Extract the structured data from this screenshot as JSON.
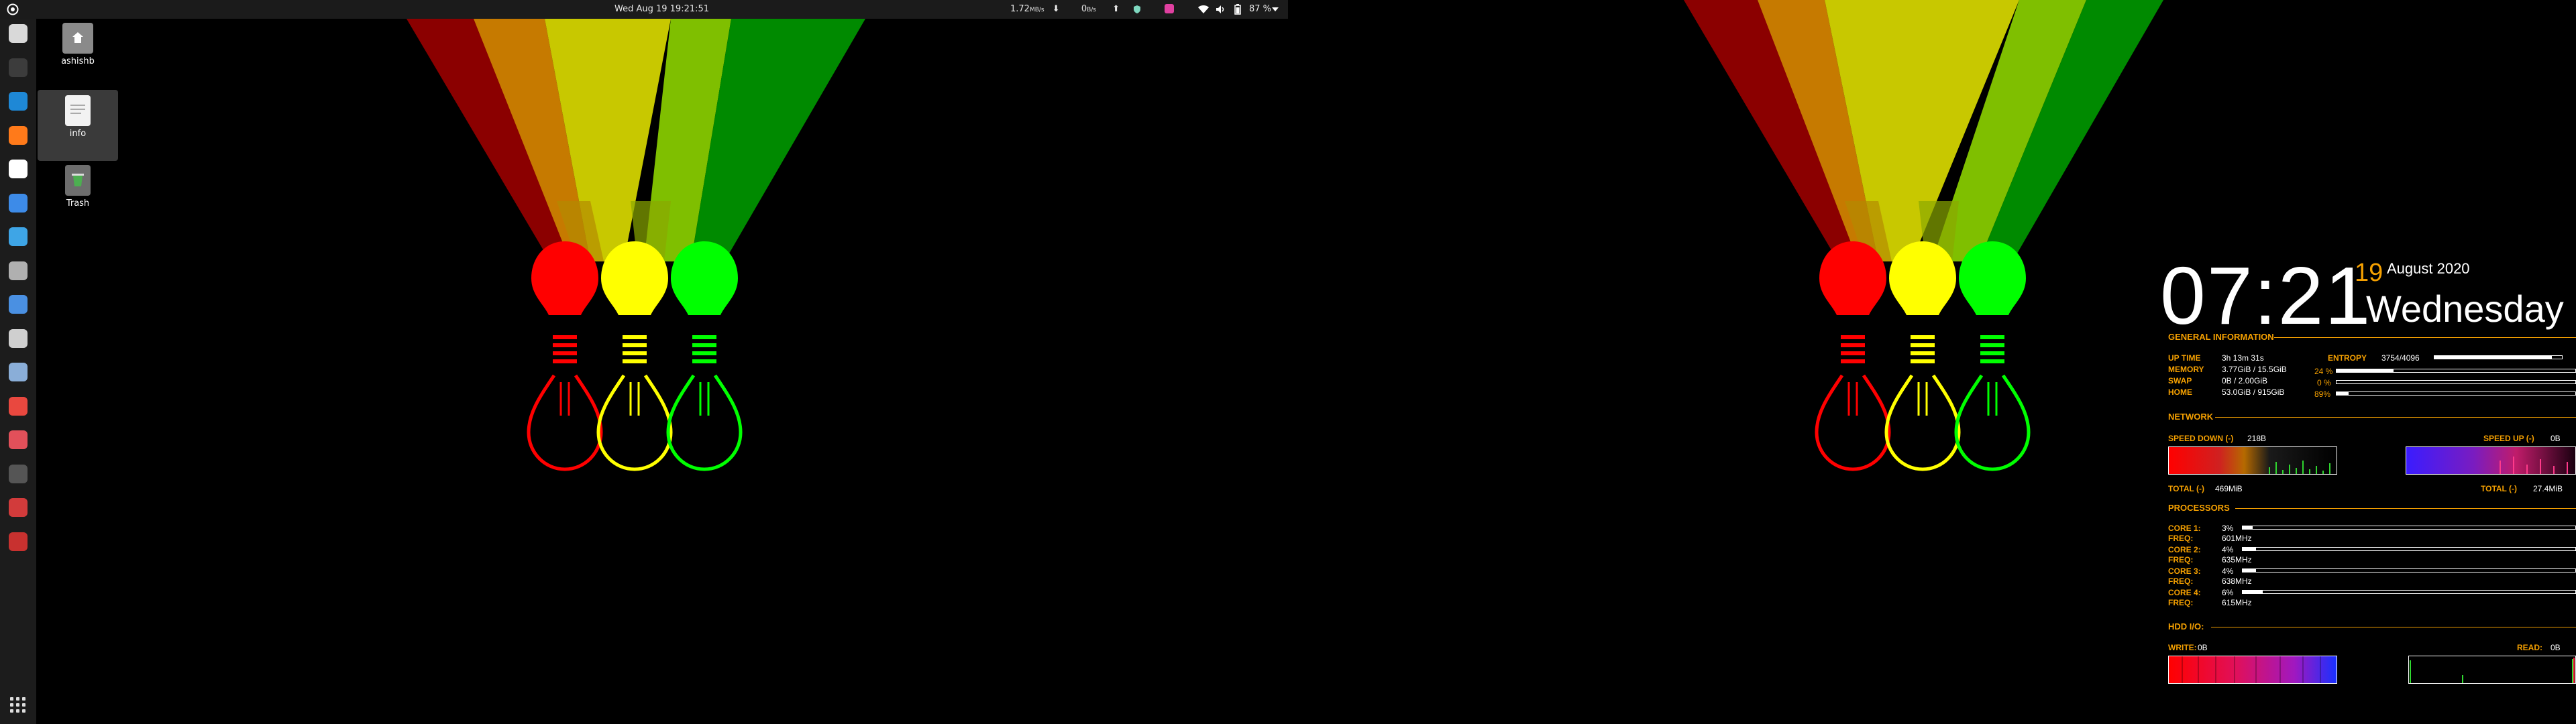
{
  "topbar": {
    "datetime": "Wed Aug 19  19:21:51",
    "net_down": "1.72",
    "net_down_unit": "MB/s",
    "net_down_arrow": "⬇",
    "net_up": "0",
    "net_up_unit": "B/s",
    "net_up_arrow": "⬆",
    "battery": "87 %"
  },
  "desktop": {
    "icons": [
      {
        "label": "ashishb"
      },
      {
        "label": "info"
      },
      {
        "label": "Trash"
      }
    ]
  },
  "dock": {
    "apps": [
      {
        "name": "files-icon",
        "color": "#d9d9d9"
      },
      {
        "name": "terminal-icon",
        "color": "#3c3c3c"
      },
      {
        "name": "vscode-icon",
        "color": "#1e88d6"
      },
      {
        "name": "firefox-icon",
        "color": "#ff7a1a"
      },
      {
        "name": "notion-icon",
        "color": "#ffffff"
      },
      {
        "name": "text-editor-icon",
        "color": "#3d8be8"
      },
      {
        "name": "telegram-icon",
        "color": "#3ea5e6"
      },
      {
        "name": "bird-app-icon",
        "color": "#b0b0b0"
      },
      {
        "name": "remote-desktop-icon",
        "color": "#4a90e2"
      },
      {
        "name": "obs-icon",
        "color": "#cfcfcf"
      },
      {
        "name": "globe-icon",
        "color": "#8aaed8"
      },
      {
        "name": "chrome-icon",
        "color": "#e9483f"
      },
      {
        "name": "system-monitor-icon",
        "color": "#e2505a"
      },
      {
        "name": "terminal-2-icon",
        "color": "#555555"
      },
      {
        "name": "flag-app-icon",
        "color": "#d23b3b"
      },
      {
        "name": "red-circle-app-icon",
        "color": "#c8312f"
      }
    ],
    "grid": "app-grid-icon"
  },
  "conky": {
    "time": "07:21",
    "day": "19",
    "month_year": "August 2020",
    "weekday": "Wednesday",
    "general": {
      "title": "GENERAL INFORMATION",
      "uptime_label": "UP TIME",
      "uptime": "3h 13m 31s",
      "memory_label": "MEMORY",
      "memory": "3.77GiB / 15.5GiB",
      "memory_pct": "24 %",
      "memory_fill": 0.24,
      "swap_label": "SWAP",
      "swap": "0B   / 2.00GiB",
      "swap_pct": "0 %",
      "swap_fill": 0.0,
      "home_label": "HOME",
      "home": "53.0GiB / 915GiB",
      "home_pct": "89%",
      "home_fill": 0.05,
      "entropy_label": "ENTROPY",
      "entropy": "3754/4096",
      "entropy_fill": 0.92
    },
    "network": {
      "title": "NETWORK",
      "down_label": "SPEED DOWN (-)",
      "down": "218B",
      "up_label": "SPEED UP (-)",
      "up": "0B",
      "total_down_label": "TOTAL (-)",
      "total_down": "469MiB",
      "total_up_label": "TOTAL (-)",
      "total_up": "27.4MiB"
    },
    "processors": {
      "title": "PROCESSORS",
      "cores": [
        {
          "core_label": "CORE 1:",
          "pct": "3%",
          "fill": 0.03,
          "freq_label": "FREQ:",
          "freq": "601MHz"
        },
        {
          "core_label": "CORE 2:",
          "pct": "4%",
          "fill": 0.04,
          "freq_label": "FREQ:",
          "freq": "635MHz"
        },
        {
          "core_label": "CORE 3:",
          "pct": "4%",
          "fill": 0.04,
          "freq_label": "FREQ:",
          "freq": "638MHz"
        },
        {
          "core_label": "CORE 4:",
          "pct": "6%",
          "fill": 0.06,
          "freq_label": "FREQ:",
          "freq": "615MHz"
        }
      ]
    },
    "hdd": {
      "title": "HDD I/O:",
      "write_label": "WRITE:",
      "write": "0B",
      "read_label": "READ:",
      "read": "0B"
    }
  }
}
